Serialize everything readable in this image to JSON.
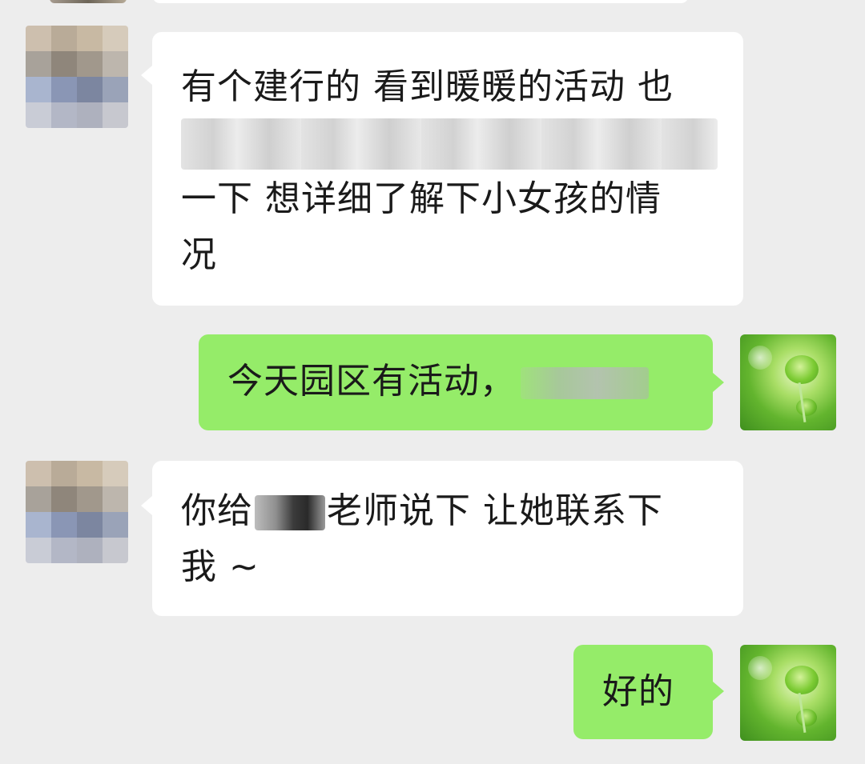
{
  "messages": [
    {
      "direction": "incoming",
      "lines": [
        "有个建行的 看到暖暖的活动 也",
        "",
        "一下  想详细了解下小女孩的情",
        "况"
      ],
      "redacted_line": "blurred-text"
    },
    {
      "direction": "outgoing",
      "text": "今天园区有活动，"
    },
    {
      "direction": "incoming",
      "line1_before": "你给",
      "line1_after": "老师说下  让她联系下",
      "line2": "我 ~"
    },
    {
      "direction": "outgoing",
      "text": "好的"
    }
  ],
  "colors": {
    "background": "#ededed",
    "incoming_bubble": "#ffffff",
    "outgoing_bubble": "#95ec69"
  },
  "icons": {
    "contact_avatar": "pixelated-avatar",
    "self_avatar": "green-flower-avatar"
  }
}
